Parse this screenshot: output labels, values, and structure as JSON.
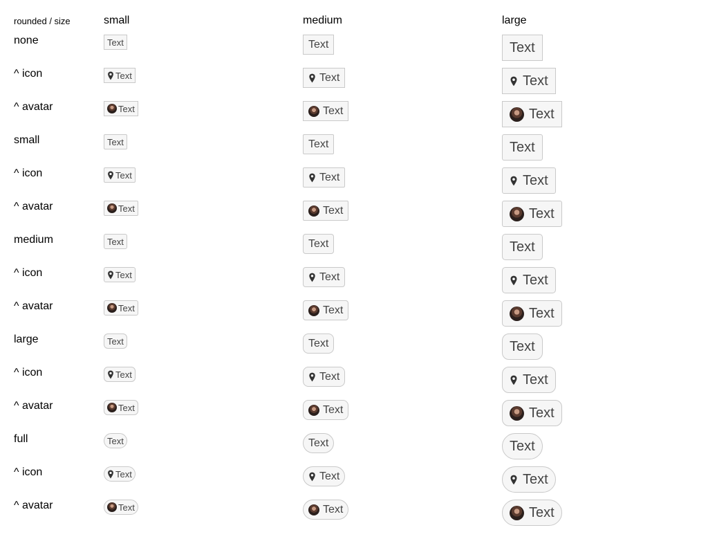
{
  "header": {
    "corner": "rounded / size",
    "sizes": [
      "small",
      "medium",
      "large"
    ]
  },
  "rows": [
    {
      "label": "none",
      "tag_text": "Text",
      "leading": "none",
      "rounded": "none"
    },
    {
      "label": "^ icon",
      "tag_text": "Text",
      "leading": "map-pin-icon",
      "rounded": "none"
    },
    {
      "label": "^ avatar",
      "tag_text": "Text",
      "leading": "avatar",
      "rounded": "none"
    },
    {
      "label": "small",
      "tag_text": "Text",
      "leading": "none",
      "rounded": "small"
    },
    {
      "label": "^ icon",
      "tag_text": "Text",
      "leading": "map-pin-icon",
      "rounded": "small"
    },
    {
      "label": "^ avatar",
      "tag_text": "Text",
      "leading": "avatar",
      "rounded": "small"
    },
    {
      "label": "medium",
      "tag_text": "Text",
      "leading": "none",
      "rounded": "medium"
    },
    {
      "label": "^ icon",
      "tag_text": "Text",
      "leading": "map-pin-icon",
      "rounded": "medium"
    },
    {
      "label": "^ avatar",
      "tag_text": "Text",
      "leading": "avatar",
      "rounded": "medium"
    },
    {
      "label": "large",
      "tag_text": "Text",
      "leading": "none",
      "rounded": "large"
    },
    {
      "label": "^ icon",
      "tag_text": "Text",
      "leading": "map-pin-icon",
      "rounded": "large"
    },
    {
      "label": "^ avatar",
      "tag_text": "Text",
      "leading": "avatar",
      "rounded": "large"
    },
    {
      "label": "full",
      "tag_text": "Text",
      "leading": "none",
      "rounded": "full"
    },
    {
      "label": "^ icon",
      "tag_text": "Text",
      "leading": "map-pin-icon",
      "rounded": "full"
    },
    {
      "label": "^ avatar",
      "tag_text": "Text",
      "leading": "avatar",
      "rounded": "full"
    }
  ],
  "colors": {
    "tag_background": "#f6f6f6",
    "tag_border": "#c9c9c9",
    "tag_text": "#444444"
  }
}
